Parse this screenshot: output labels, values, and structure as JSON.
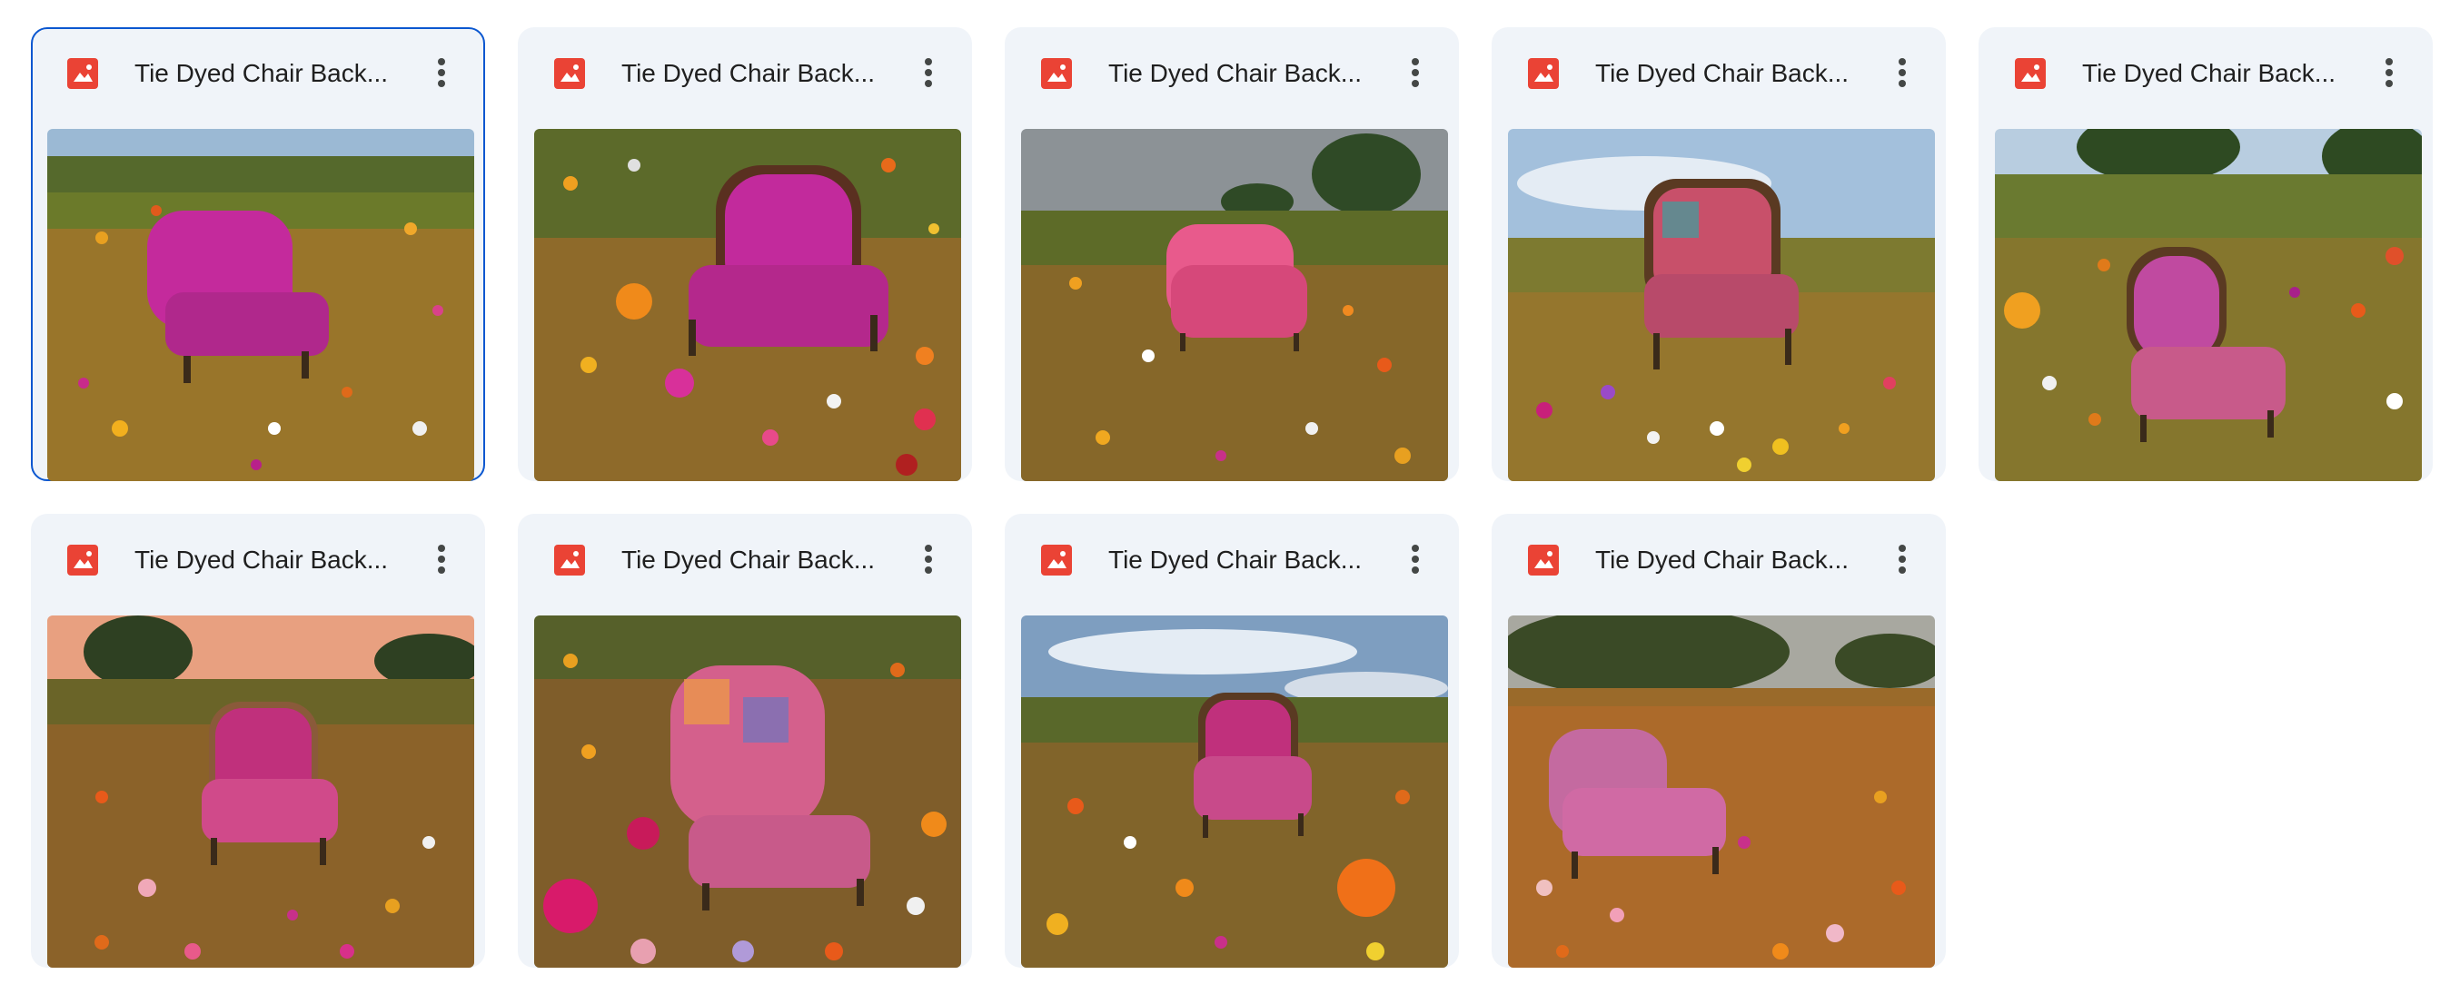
{
  "files": [
    {
      "name": "Tie Dyed Chair Back...",
      "selected": true,
      "icon": "image-file-icon"
    },
    {
      "name": "Tie Dyed Chair Back...",
      "selected": false,
      "icon": "image-file-icon"
    },
    {
      "name": "Tie Dyed Chair Back...",
      "selected": false,
      "icon": "image-file-icon"
    },
    {
      "name": "Tie Dyed Chair Back...",
      "selected": false,
      "icon": "image-file-icon"
    },
    {
      "name": "Tie Dyed Chair Back...",
      "selected": false,
      "icon": "image-file-icon"
    },
    {
      "name": "Tie Dyed Chair Back...",
      "selected": false,
      "icon": "image-file-icon"
    },
    {
      "name": "Tie Dyed Chair Back...",
      "selected": false,
      "icon": "image-file-icon"
    },
    {
      "name": "Tie Dyed Chair Back...",
      "selected": false,
      "icon": "image-file-icon"
    },
    {
      "name": "Tie Dyed Chair Back...",
      "selected": false,
      "icon": "image-file-icon"
    }
  ],
  "colors": {
    "card_bg": "#f0f4f9",
    "selected_border": "#0b57d0",
    "image_icon": "#ea4335",
    "more_dots": "#444746"
  }
}
